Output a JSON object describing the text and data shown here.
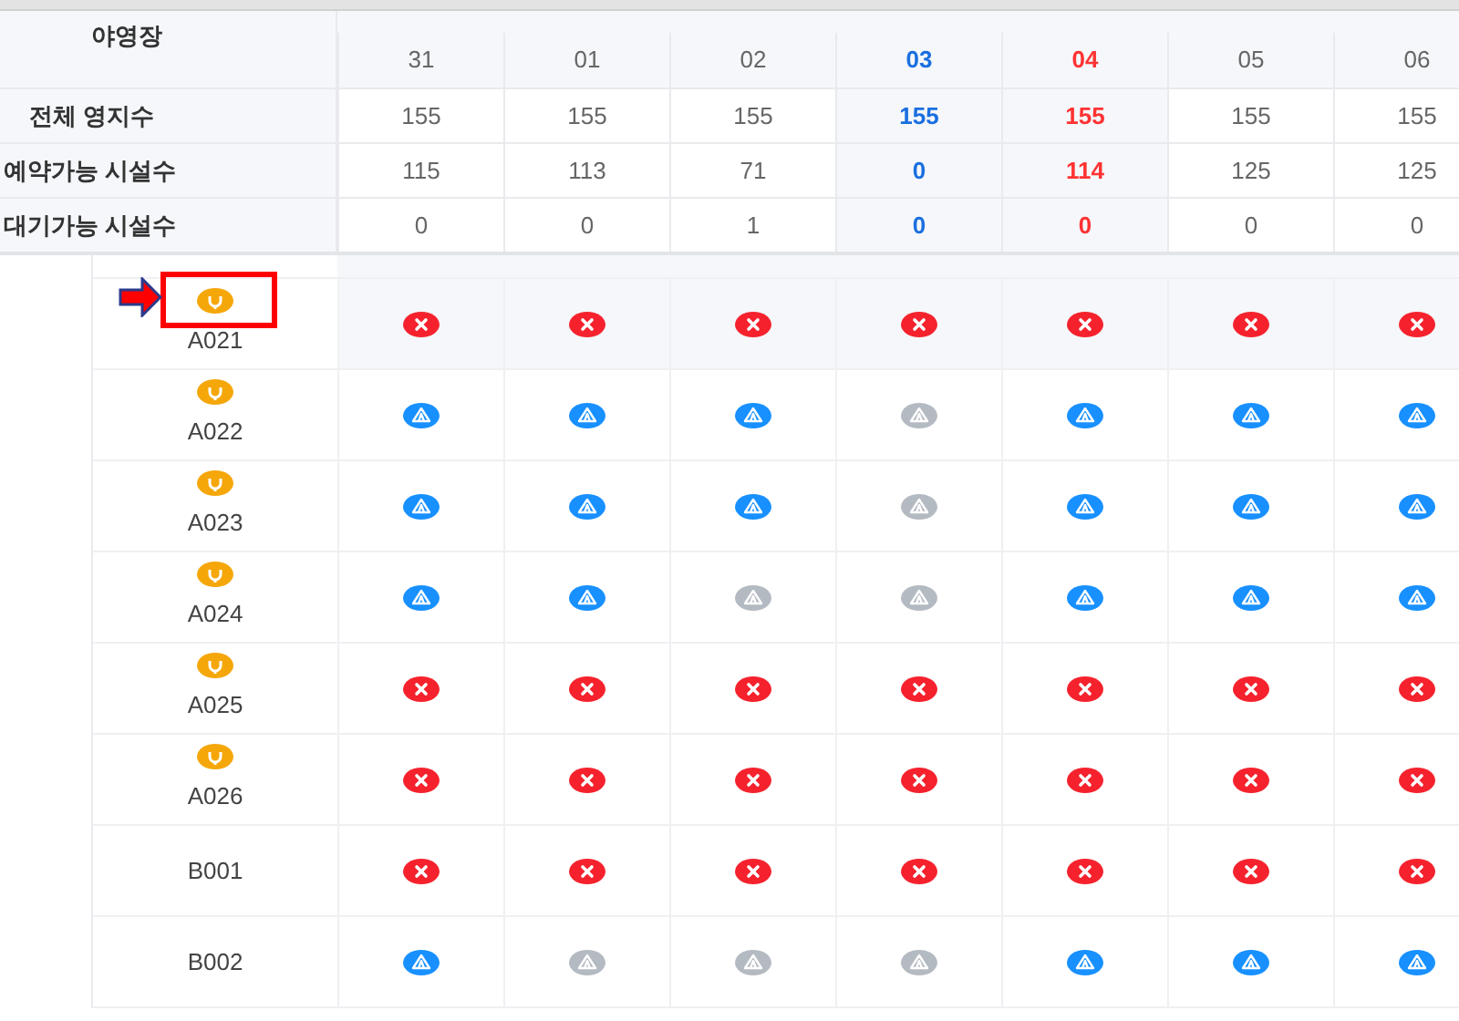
{
  "corner_label": "야영장",
  "dates": [
    {
      "label": "31",
      "kind": "weekday"
    },
    {
      "label": "01",
      "kind": "weekday"
    },
    {
      "label": "02",
      "kind": "weekday"
    },
    {
      "label": "03",
      "kind": "saturday"
    },
    {
      "label": "04",
      "kind": "sunday"
    },
    {
      "label": "05",
      "kind": "weekday"
    },
    {
      "label": "06",
      "kind": "weekday"
    }
  ],
  "summary_rows": [
    {
      "label": "전체 영지수",
      "values": [
        "155",
        "155",
        "155",
        "155",
        "155",
        "155",
        "155"
      ]
    },
    {
      "label": "예약가능 시설수",
      "values": [
        "115",
        "113",
        "71",
        "0",
        "114",
        "125",
        "125"
      ]
    },
    {
      "label": "대기가능 시설수",
      "values": [
        "0",
        "0",
        "1",
        "0",
        "0",
        "0",
        "0"
      ]
    }
  ],
  "sites": [
    {
      "name": "A021",
      "electric": true,
      "marked": true,
      "cells": [
        {
          "kind": "full"
        },
        {
          "kind": "full"
        },
        {
          "kind": "full"
        },
        {
          "kind": "full"
        },
        {
          "kind": "full"
        },
        {
          "kind": "full"
        },
        {
          "kind": "full"
        }
      ]
    },
    {
      "name": "A022",
      "electric": true,
      "marked": false,
      "cells": [
        {
          "kind": "open"
        },
        {
          "kind": "open"
        },
        {
          "kind": "open"
        },
        {
          "kind": "closed"
        },
        {
          "kind": "open"
        },
        {
          "kind": "open"
        },
        {
          "kind": "open"
        }
      ]
    },
    {
      "name": "A023",
      "electric": true,
      "marked": false,
      "cells": [
        {
          "kind": "open"
        },
        {
          "kind": "open"
        },
        {
          "kind": "open"
        },
        {
          "kind": "closed"
        },
        {
          "kind": "open"
        },
        {
          "kind": "open"
        },
        {
          "kind": "open"
        }
      ]
    },
    {
      "name": "A024",
      "electric": true,
      "marked": false,
      "cells": [
        {
          "kind": "open"
        },
        {
          "kind": "open"
        },
        {
          "kind": "closed"
        },
        {
          "kind": "closed"
        },
        {
          "kind": "open"
        },
        {
          "kind": "open"
        },
        {
          "kind": "open"
        }
      ]
    },
    {
      "name": "A025",
      "electric": true,
      "marked": false,
      "cells": [
        {
          "kind": "full"
        },
        {
          "kind": "full"
        },
        {
          "kind": "full"
        },
        {
          "kind": "full"
        },
        {
          "kind": "full"
        },
        {
          "kind": "full"
        },
        {
          "kind": "full"
        }
      ]
    },
    {
      "name": "A026",
      "electric": true,
      "marked": false,
      "cells": [
        {
          "kind": "full"
        },
        {
          "kind": "full"
        },
        {
          "kind": "full"
        },
        {
          "kind": "full"
        },
        {
          "kind": "full"
        },
        {
          "kind": "full"
        },
        {
          "kind": "full"
        }
      ]
    },
    {
      "name": "B001",
      "electric": false,
      "marked": false,
      "cells": [
        {
          "kind": "full"
        },
        {
          "kind": "full"
        },
        {
          "kind": "full"
        },
        {
          "kind": "full"
        },
        {
          "kind": "full"
        },
        {
          "kind": "full"
        },
        {
          "kind": "full"
        }
      ]
    },
    {
      "name": "B002",
      "electric": false,
      "marked": false,
      "cells": [
        {
          "kind": "open"
        },
        {
          "kind": "closed"
        },
        {
          "kind": "closed"
        },
        {
          "kind": "closed"
        },
        {
          "kind": "open"
        },
        {
          "kind": "open"
        },
        {
          "kind": "open"
        }
      ]
    }
  ]
}
